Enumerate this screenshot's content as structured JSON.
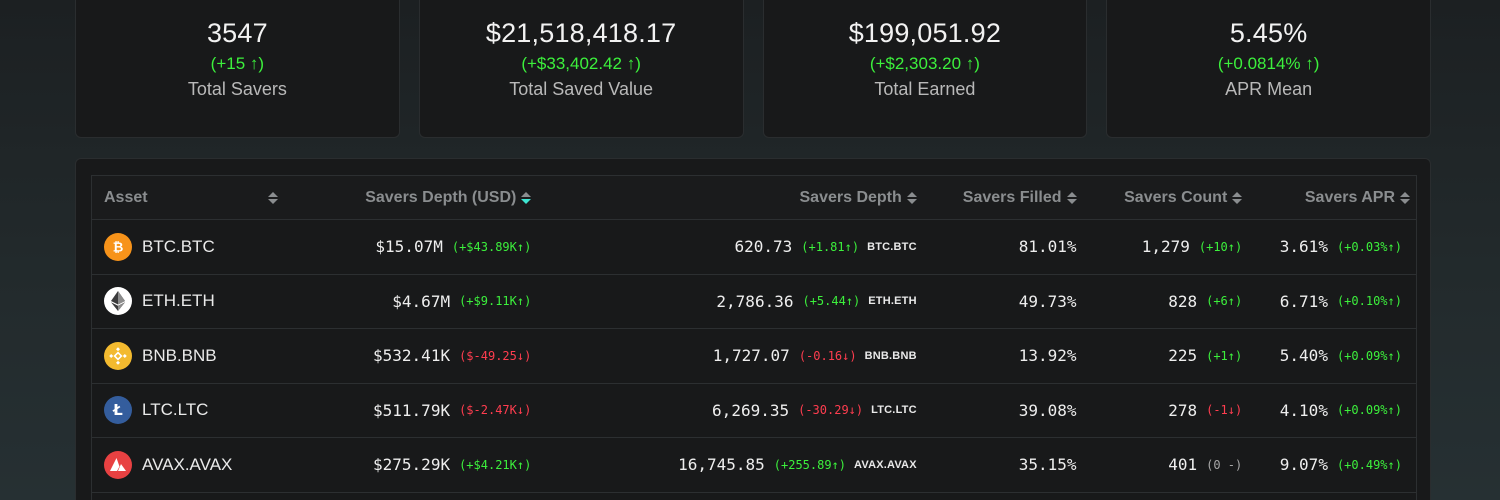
{
  "stats": [
    {
      "value": "3547",
      "change": "(+15 ↑)",
      "label": "Total Savers"
    },
    {
      "value": "$21,518,418.17",
      "change": "(+$33,402.42 ↑)",
      "label": "Total Saved Value"
    },
    {
      "value": "$199,051.92",
      "change": "(+$2,303.20 ↑)",
      "label": "Total Earned"
    },
    {
      "value": "5.45%",
      "change": "(+0.0814% ↑)",
      "label": "APR Mean"
    }
  ],
  "table": {
    "headers": {
      "asset": "Asset",
      "usd": "Savers Depth (USD)",
      "depth": "Savers Depth",
      "filled": "Savers Filled",
      "count": "Savers Count",
      "apr": "Savers APR"
    },
    "sorted_column": "usd",
    "rows": [
      {
        "asset": "BTC.BTC",
        "icon": "bitcoin-icon",
        "color": "#f7931a",
        "usd": "$15.07M",
        "usd_chg": "(+$43.89K↑)",
        "usd_dir": "up",
        "depth": "620.73",
        "depth_chg": "(+1.81↑)",
        "depth_dir": "up",
        "depth_unit": "BTC.BTC",
        "filled": "81.01%",
        "count": "1,279",
        "count_chg": "(+10↑)",
        "count_dir": "up",
        "apr": "3.61%",
        "apr_chg": "(+0.03%↑)",
        "apr_dir": "up"
      },
      {
        "asset": "ETH.ETH",
        "icon": "ethereum-icon",
        "color": "#ffffff",
        "usd": "$4.67M",
        "usd_chg": "(+$9.11K↑)",
        "usd_dir": "up",
        "depth": "2,786.36",
        "depth_chg": "(+5.44↑)",
        "depth_dir": "up",
        "depth_unit": "ETH.ETH",
        "filled": "49.73%",
        "count": "828",
        "count_chg": "(+6↑)",
        "count_dir": "up",
        "apr": "6.71%",
        "apr_chg": "(+0.10%↑)",
        "apr_dir": "up"
      },
      {
        "asset": "BNB.BNB",
        "icon": "bnb-icon",
        "color": "#f3ba2f",
        "usd": "$532.41K",
        "usd_chg": "($-49.25↓)",
        "usd_dir": "dn",
        "depth": "1,727.07",
        "depth_chg": "(-0.16↓)",
        "depth_dir": "dn",
        "depth_unit": "BNB.BNB",
        "filled": "13.92%",
        "count": "225",
        "count_chg": "(+1↑)",
        "count_dir": "up",
        "apr": "5.40%",
        "apr_chg": "(+0.09%↑)",
        "apr_dir": "up"
      },
      {
        "asset": "LTC.LTC",
        "icon": "litecoin-icon",
        "color": "#345d9d",
        "usd": "$511.79K",
        "usd_chg": "($-2.47K↓)",
        "usd_dir": "dn",
        "depth": "6,269.35",
        "depth_chg": "(-30.29↓)",
        "depth_dir": "dn",
        "depth_unit": "LTC.LTC",
        "filled": "39.08%",
        "count": "278",
        "count_chg": "(-1↓)",
        "count_dir": "dn",
        "apr": "4.10%",
        "apr_chg": "(+0.09%↑)",
        "apr_dir": "up"
      },
      {
        "asset": "AVAX.AVAX",
        "icon": "avalanche-icon",
        "color": "#e84142",
        "usd": "$275.29K",
        "usd_chg": "(+$4.21K↑)",
        "usd_dir": "up",
        "depth": "16,745.85",
        "depth_chg": "(+255.89↑)",
        "depth_dir": "up",
        "depth_unit": "AVAX.AVAX",
        "filled": "35.15%",
        "count": "401",
        "count_chg": "(0 -)",
        "count_dir": "nt",
        "apr": "9.07%",
        "apr_chg": "(+0.49%↑)",
        "apr_dir": "up"
      }
    ]
  }
}
